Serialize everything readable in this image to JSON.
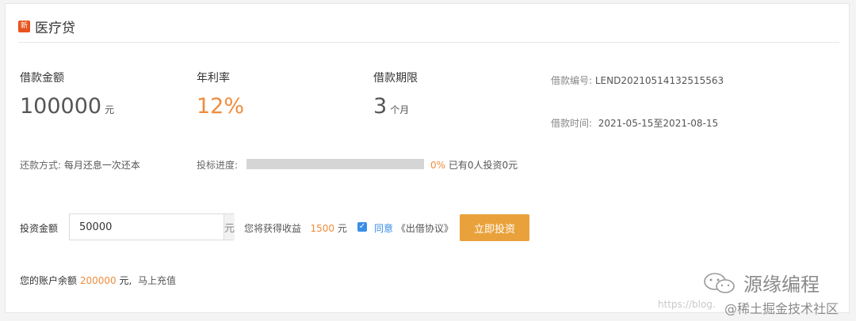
{
  "header": {
    "badge": "新",
    "title": "医疗贷"
  },
  "loan": {
    "amount_label": "借款金额",
    "amount": "100000",
    "amount_unit": "元",
    "rate_label": "年利率",
    "rate": "12%",
    "term_label": "借款期限",
    "term": "3",
    "term_unit": "个月",
    "number_label": "借款编号:",
    "number": "LEND20210514132515563",
    "time_label": "借款时间:",
    "time": "2021-05-15至2021-08-15",
    "repay_label": "还款方式:",
    "repay": "每月还息一次还本",
    "progress_label": "投标进度:",
    "progress_text": "0%",
    "progress_value": 0,
    "progress_note": "已有0人投资0元"
  },
  "invest": {
    "label": "投资金额",
    "value": "50000",
    "unit": "元",
    "expected_label": "您将获得收益",
    "expected": "1500",
    "expected_unit": "元",
    "agree": "同意",
    "agreement": "《出借协议》",
    "button": "立即投资"
  },
  "account": {
    "label": "您的账户余额",
    "balance": "200000",
    "unit": "元,",
    "recharge": "马上充值"
  },
  "watermark": {
    "brand": "源缘编程",
    "site": "@稀土掘金技术社区",
    "url": "https://blog."
  },
  "colors": {
    "accent": "#f08c3c",
    "button": "#e9a23b",
    "link": "#3a8ee6",
    "badge": "#e8541e"
  }
}
